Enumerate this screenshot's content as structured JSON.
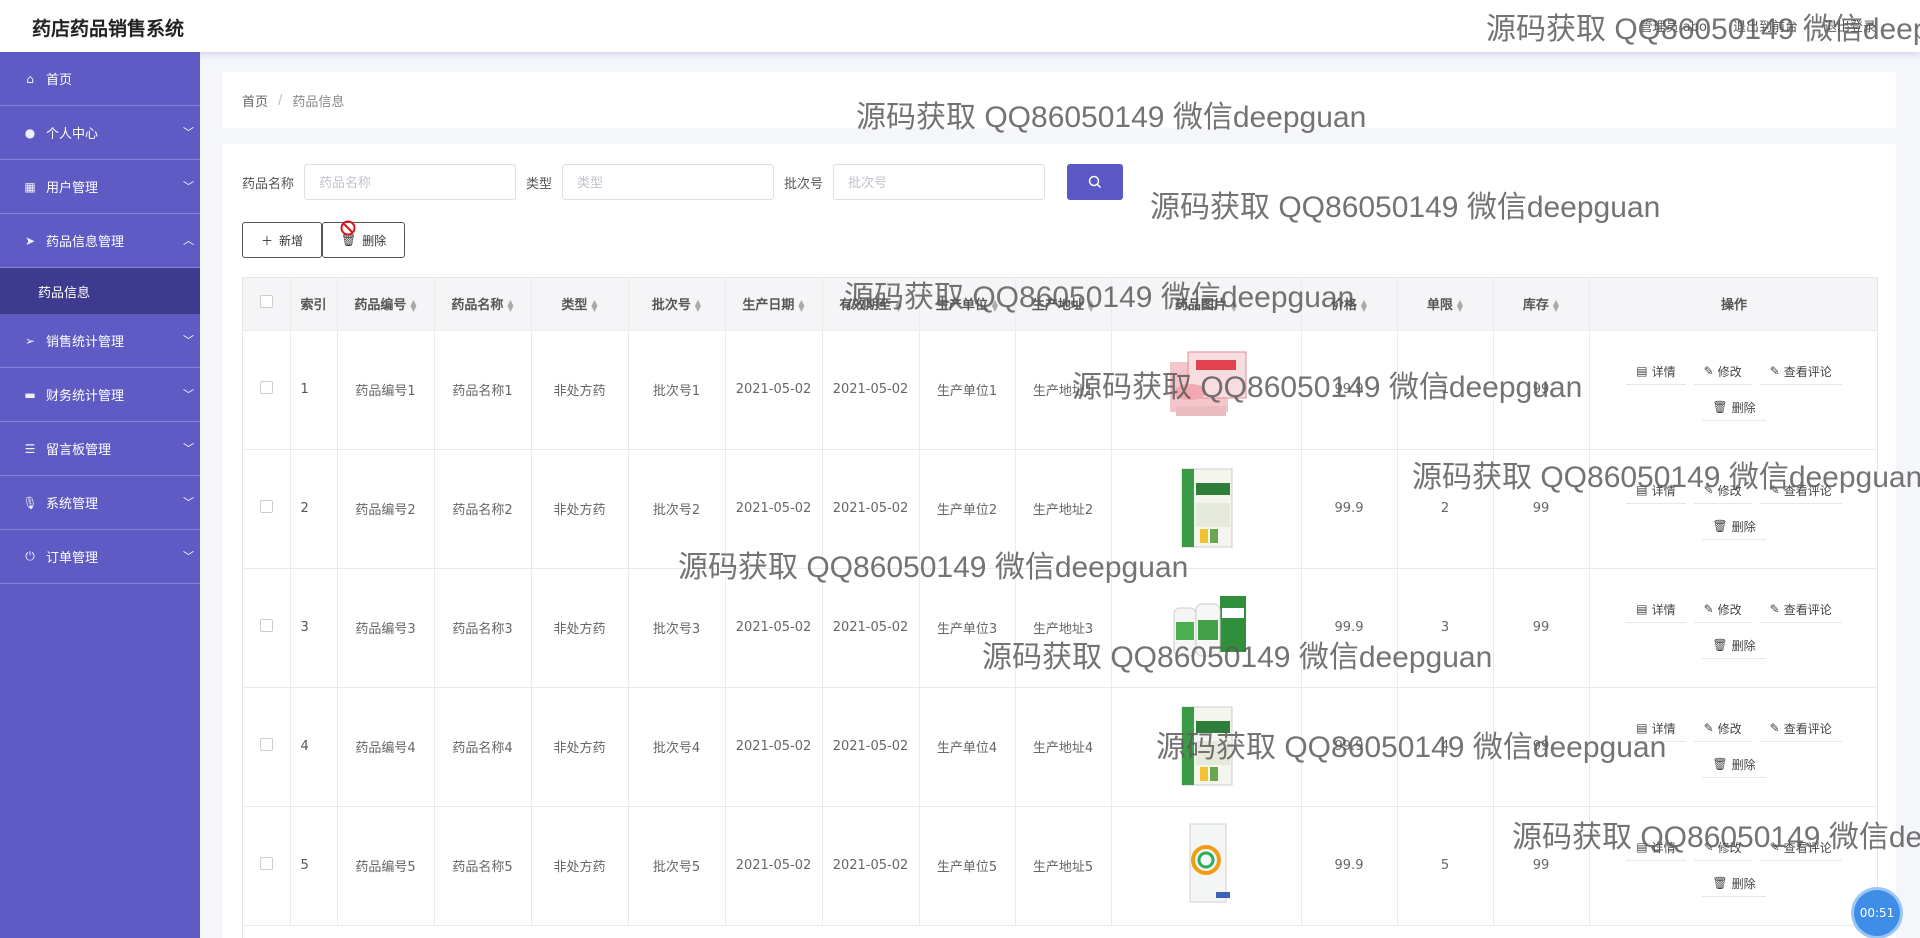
{
  "app": {
    "title": "药店药品销售系统"
  },
  "header": {
    "links": [
      "管理员 abo",
      "退出到前台",
      "退出登录"
    ]
  },
  "sidebar": {
    "items": [
      {
        "label": "首页",
        "icon": "home-icon",
        "expandable": false
      },
      {
        "label": "个人中心",
        "icon": "user-icon",
        "expandable": true
      },
      {
        "label": "用户管理",
        "icon": "grid-icon",
        "expandable": true
      },
      {
        "label": "药品信息管理",
        "icon": "send-icon",
        "expandable": true,
        "expanded": true,
        "children": [
          "药品信息"
        ]
      },
      {
        "label": "销售统计管理",
        "icon": "send-icon",
        "expandable": true
      },
      {
        "label": "财务统计管理",
        "icon": "card-icon",
        "expandable": true
      },
      {
        "label": "留言板管理",
        "icon": "sliders-icon",
        "expandable": true
      },
      {
        "label": "系统管理",
        "icon": "mic-icon",
        "expandable": true
      },
      {
        "label": "订单管理",
        "icon": "power-icon",
        "expandable": true
      }
    ]
  },
  "breadcrumb": {
    "home": "首页",
    "separator": "/",
    "current": "药品信息"
  },
  "search": {
    "name_label": "药品名称",
    "name_placeholder": "药品名称",
    "type_label": "类型",
    "type_placeholder": "类型",
    "batch_label": "批次号",
    "batch_placeholder": "批次号"
  },
  "actions": {
    "add": "新增",
    "delete": "删除"
  },
  "table": {
    "headers": [
      "索引",
      "药品编号",
      "药品名称",
      "类型",
      "批次号",
      "生产日期",
      "有效期至",
      "生产单位",
      "生产地址",
      "药品图片",
      "价格",
      "单限",
      "库存",
      "操作"
    ],
    "rows": [
      {
        "index": "1",
        "code": "药品编号1",
        "name": "药品名称1",
        "type": "非处方药",
        "batch": "批次号1",
        "prod_date": "2021-05-02",
        "expiry": "2021-05-02",
        "unit": "生产单位1",
        "address": "生产地址1",
        "price": "99.9",
        "limit": "1",
        "stock": "99",
        "image": "pink-box"
      },
      {
        "index": "2",
        "code": "药品编号2",
        "name": "药品名称2",
        "type": "非处方药",
        "batch": "批次号2",
        "prod_date": "2021-05-02",
        "expiry": "2021-05-02",
        "unit": "生产单位2",
        "address": "生产地址2",
        "price": "99.9",
        "limit": "2",
        "stock": "99",
        "image": "green-box"
      },
      {
        "index": "3",
        "code": "药品编号3",
        "name": "药品名称3",
        "type": "非处方药",
        "batch": "批次号3",
        "prod_date": "2021-05-02",
        "expiry": "2021-05-02",
        "unit": "生产单位3",
        "address": "生产地址3",
        "price": "99.9",
        "limit": "3",
        "stock": "99",
        "image": "bottles"
      },
      {
        "index": "4",
        "code": "药品编号4",
        "name": "药品名称4",
        "type": "非处方药",
        "batch": "批次号4",
        "prod_date": "2021-05-02",
        "expiry": "2021-05-02",
        "unit": "生产单位4",
        "address": "生产地址4",
        "price": "99.9",
        "limit": "4",
        "stock": "99",
        "image": "green-box"
      },
      {
        "index": "5",
        "code": "药品编号5",
        "name": "药品名称5",
        "type": "非处方药",
        "batch": "批次号5",
        "prod_date": "2021-05-02",
        "expiry": "2021-05-02",
        "unit": "生产单位5",
        "address": "生产地址5",
        "price": "99.9",
        "limit": "5",
        "stock": "99",
        "image": "white-box"
      }
    ],
    "ops": {
      "detail": "详情",
      "edit": "修改",
      "review": "查看评论",
      "delete": "删除"
    }
  },
  "watermark": "源码获取 QQ86050149 微信deepguan",
  "timer": "00:51",
  "colors": {
    "sidebar": "#5f5bc5",
    "sidebar_active": "#3e3a8f",
    "primary": "#5a57c6"
  }
}
